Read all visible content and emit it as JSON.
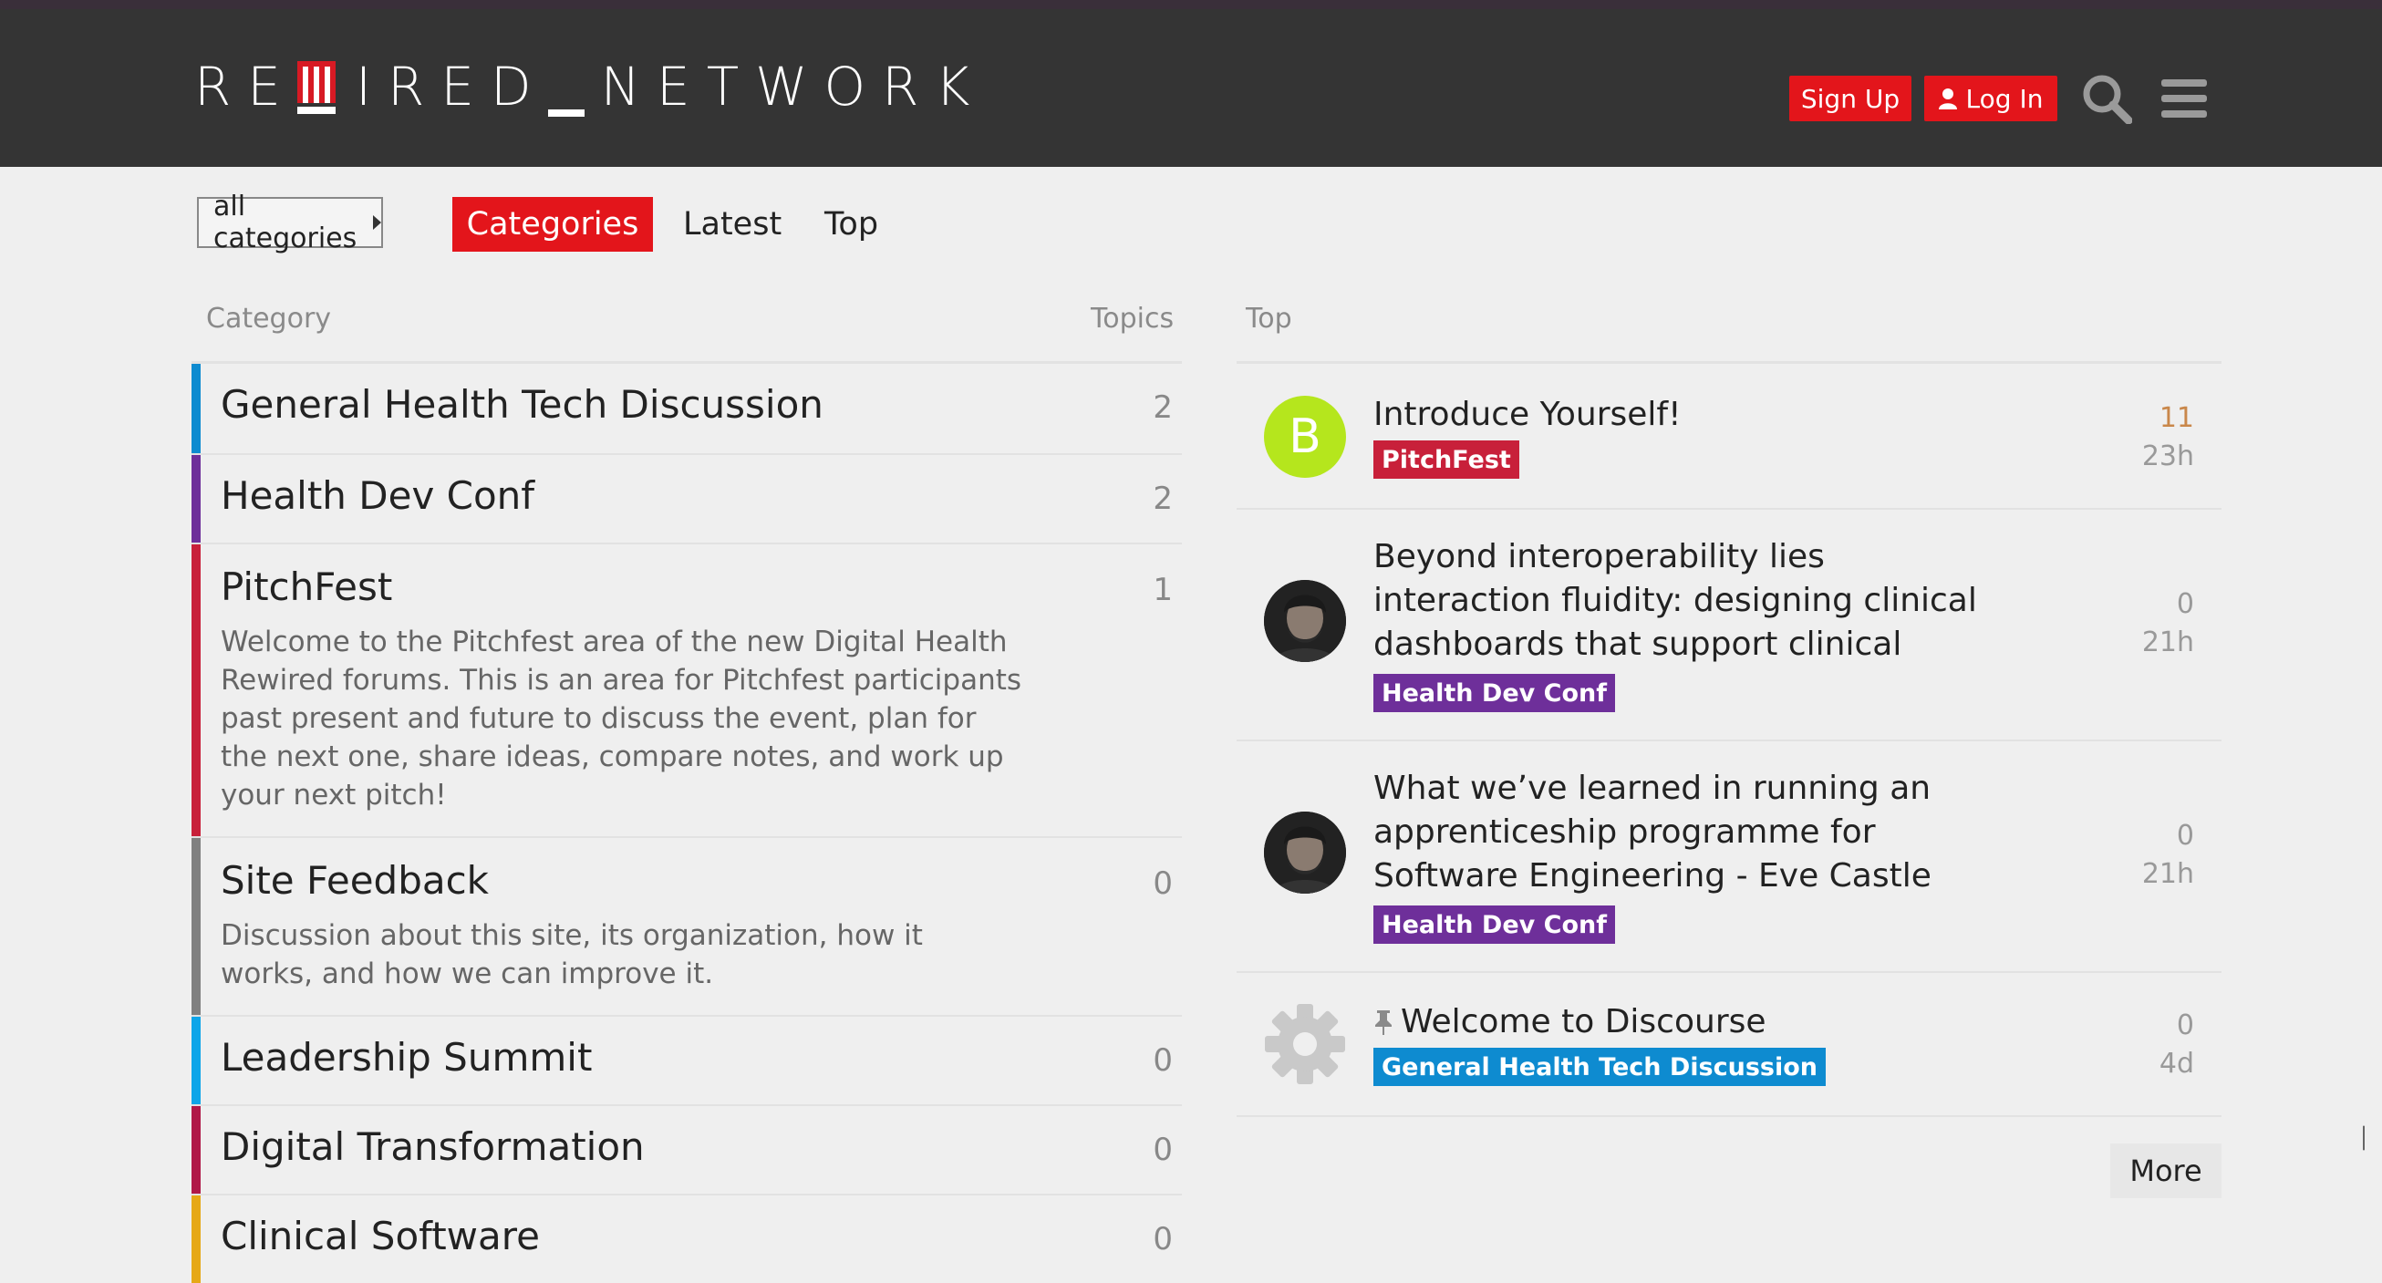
{
  "header": {
    "logo_text_parts": [
      "RE",
      "IRED",
      "NETWORK"
    ],
    "signup_label": "Sign Up",
    "login_label": "Log In",
    "accent_color": "#e3151b",
    "bg_color": "#343434"
  },
  "nav": {
    "category_dropdown": "all categories",
    "tabs": [
      {
        "label": "Categories",
        "active": true
      },
      {
        "label": "Latest",
        "active": false
      },
      {
        "label": "Top",
        "active": false
      }
    ]
  },
  "categories_table": {
    "col_category": "Category",
    "col_topics": "Topics",
    "rows": [
      {
        "name": "General Health Tech Discussion",
        "count": "2",
        "color": "#0e8bd0",
        "description": ""
      },
      {
        "name": "Health Dev Conf",
        "count": "2",
        "color": "#6e2f9a",
        "description": ""
      },
      {
        "name": "PitchFest",
        "count": "1",
        "color": "#c8203a",
        "description": "Welcome to the Pitchfest area of the new Digital Health Rewired forums. This is an area for Pitchfest participants past present and future to discuss the event, plan for the next one, share ideas, compare notes, and work up your next pitch!"
      },
      {
        "name": "Site Feedback",
        "count": "0",
        "color": "#808080",
        "description": "Discussion about this site, its organization, how it works, and how we can improve it."
      },
      {
        "name": "Leadership Summit",
        "count": "0",
        "color": "#0ea5e9",
        "description": ""
      },
      {
        "name": "Digital Transformation",
        "count": "0",
        "color": "#b01848",
        "description": ""
      },
      {
        "name": "Clinical Software",
        "count": "0",
        "color": "#e6a817",
        "description": ""
      }
    ]
  },
  "top_table": {
    "col_top": "Top",
    "rows": [
      {
        "title": "Introduce Yourself!",
        "category": "PitchFest",
        "category_color": "#c8203a",
        "count": "11",
        "count_color": "#c9874a",
        "age": "23h",
        "avatar": "B",
        "avatar_type": "letter"
      },
      {
        "title": "Beyond interoperability lies interaction fluidity: designing clinical dashboards that support clinical reasoning",
        "category": "Health Dev Conf",
        "category_color": "#6e2f9a",
        "count": "0",
        "age": "21h",
        "avatar_type": "photo"
      },
      {
        "title": "What we’ve learned in running an apprenticeship programme for Software Engineering - Eve Castle",
        "category": "Health Dev Conf",
        "category_color": "#6e2f9a",
        "count": "0",
        "age": "21h",
        "avatar_type": "photo"
      },
      {
        "title": "Welcome to Discourse",
        "category": "General Health Tech Discussion",
        "category_color": "#0e8bd0",
        "count": "0",
        "age": "4d",
        "avatar_type": "gear",
        "pinned": true
      }
    ],
    "more_label": "More"
  },
  "icons": [
    "search-icon",
    "hamburger-menu-icon",
    "user-icon",
    "pin-icon",
    "gear-icon",
    "caret-right-icon"
  ]
}
